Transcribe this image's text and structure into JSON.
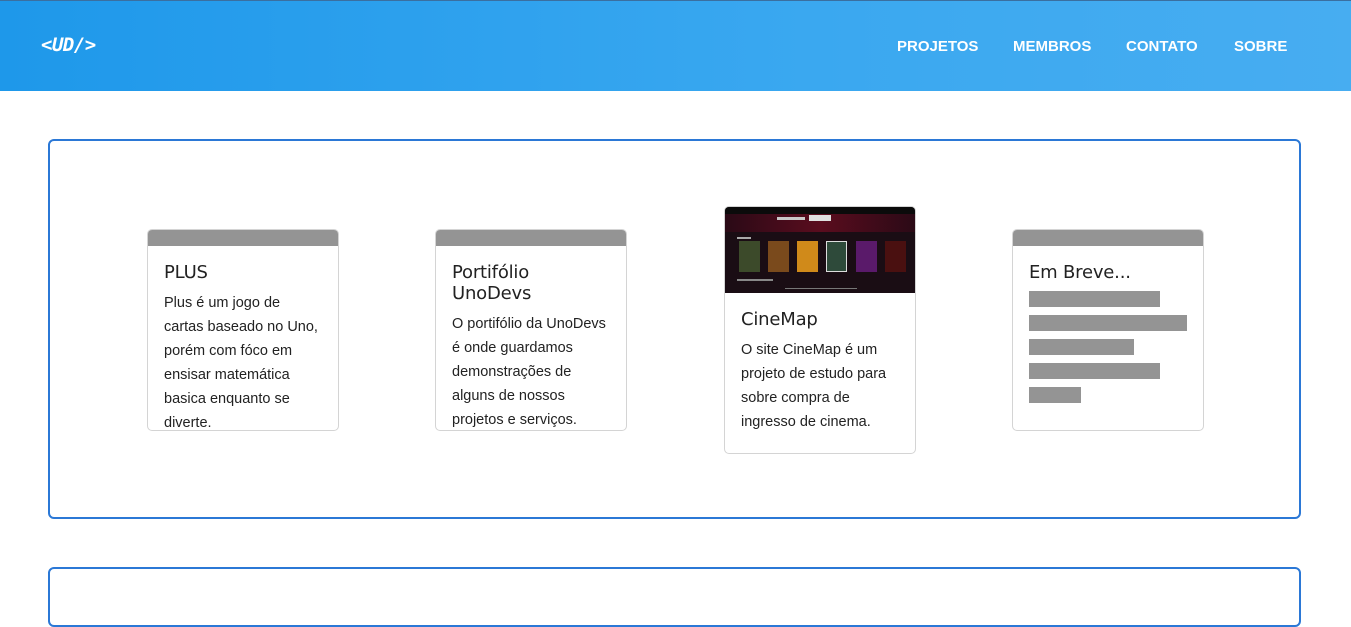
{
  "header": {
    "logo": "<UD/>",
    "nav": [
      "PROJETOS",
      "MEMBROS",
      "CONTATO",
      "SOBRE"
    ]
  },
  "cards": [
    {
      "title": "PLUS",
      "desc": "Plus é um jogo de cartas baseado no Uno, porém com fóco em ensisar matemática basica enquanto se diverte."
    },
    {
      "title": "Portifólio UnoDevs",
      "desc": "O portifólio da UnoDevs é onde guardamos demonstrações de alguns de nossos projetos e serviços."
    },
    {
      "title": "CineMap",
      "desc": "O site CineMap é um projeto de estudo para sobre compra de ingresso de cinema.",
      "thumb_alt": "CineMap website screenshot"
    },
    {
      "title": "Em Breve...",
      "placeholder_lines": 5
    }
  ],
  "colors": {
    "accent": "#2b78d6",
    "header": "#2ea2ee",
    "card_bar": "#949494"
  }
}
